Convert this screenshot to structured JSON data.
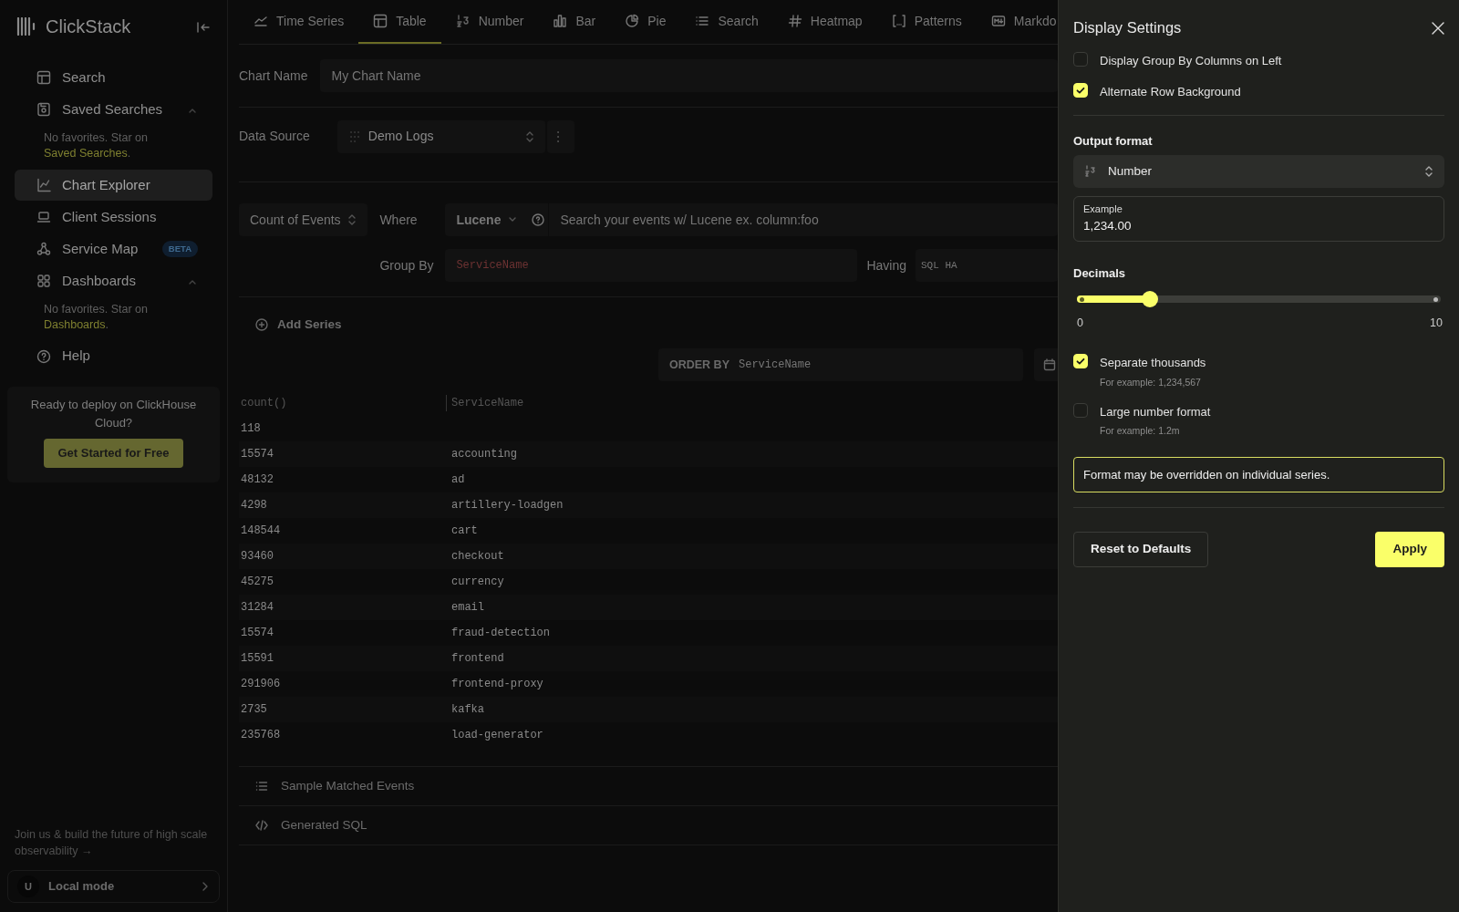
{
  "sidebar": {
    "logo": "ClickStack",
    "items": [
      {
        "kind": "link",
        "label": "Search",
        "selected": false
      },
      {
        "kind": "section",
        "label": "Saved Searches",
        "selected": false,
        "expanded": true,
        "note": {
          "text": "No favorites. Star on ",
          "link": "Saved Searches",
          "end": "."
        }
      },
      {
        "kind": "link",
        "label": "Chart Explorer",
        "selected": true
      },
      {
        "kind": "link",
        "label": "Client Sessions",
        "selected": false
      },
      {
        "kind": "link",
        "label": "Service Map",
        "selected": false,
        "badge": "BETA"
      },
      {
        "kind": "section",
        "label": "Dashboards",
        "selected": false,
        "expanded": true,
        "note": {
          "text": "No favorites. Star on ",
          "link": "Dashboards",
          "end": "."
        }
      },
      {
        "kind": "link",
        "label": "Help",
        "selected": false
      }
    ],
    "promo": {
      "text": "Ready to deploy on ClickHouse Cloud?",
      "button": "Get Started for Free"
    },
    "footer_link": "Join us & build the future of high scale observability →",
    "user": {
      "avatar": "U",
      "label": "Local mode"
    }
  },
  "tabs": [
    {
      "label": "Time Series",
      "selected": false
    },
    {
      "label": "Table",
      "selected": true
    },
    {
      "label": "Number",
      "selected": false
    },
    {
      "label": "Bar",
      "selected": false
    },
    {
      "label": "Pie",
      "selected": false
    },
    {
      "label": "Search",
      "selected": false
    },
    {
      "label": "Heatmap",
      "selected": false
    },
    {
      "label": "Patterns",
      "selected": false
    },
    {
      "label": "Markdo",
      "selected": false
    }
  ],
  "chart_name": {
    "label": "Chart Name",
    "placeholder": "My Chart Name"
  },
  "data_source": {
    "label": "Data Source",
    "value": "Demo Logs"
  },
  "series": {
    "aggregate": "Count of Events",
    "where_label": "Where",
    "language": "Lucene",
    "where_placeholder": "Search your events w/ Lucene ex. column:foo",
    "group_by_label": "Group By",
    "group_by": "ServiceName",
    "having_label": "Having",
    "having_placeholder": "SQL HA"
  },
  "add_series": "Add Series",
  "order_by": {
    "label": "ORDER BY",
    "placeholder": "ServiceName"
  },
  "table": {
    "columns": [
      "count()",
      "ServiceName"
    ],
    "rows": [
      [
        "118",
        ""
      ],
      [
        "15574",
        "accounting"
      ],
      [
        "48132",
        "ad"
      ],
      [
        "4298",
        "artillery-loadgen"
      ],
      [
        "148544",
        "cart"
      ],
      [
        "93460",
        "checkout"
      ],
      [
        "45275",
        "currency"
      ],
      [
        "31284",
        "email"
      ],
      [
        "15574",
        "fraud-detection"
      ],
      [
        "15591",
        "frontend"
      ],
      [
        "291906",
        "frontend-proxy"
      ],
      [
        "2735",
        "kafka"
      ],
      [
        "235768",
        "load-generator"
      ]
    ]
  },
  "sections": [
    "Sample Matched Events",
    "Generated SQL"
  ],
  "drawer": {
    "title": "Display Settings",
    "checkboxes": [
      {
        "label": "Display Group By Columns on Left",
        "checked": false
      },
      {
        "label": "Alternate Row Background",
        "checked": true
      }
    ],
    "output_format": {
      "label": "Output format",
      "value": "Number"
    },
    "example": {
      "label": "Example",
      "value": "1,234.00"
    },
    "decimals": {
      "label": "Decimals",
      "level": 0.2,
      "min": "0",
      "max": "10"
    },
    "options": [
      {
        "label": "Separate thousands",
        "hint": "For example: 1,234,567",
        "checked": true
      },
      {
        "label": "Large number format",
        "hint": "For example: 1.2m",
        "checked": false
      }
    ],
    "note": "Format may be overridden on individual series.",
    "reset": "Reset to Defaults",
    "apply": "Apply"
  }
}
